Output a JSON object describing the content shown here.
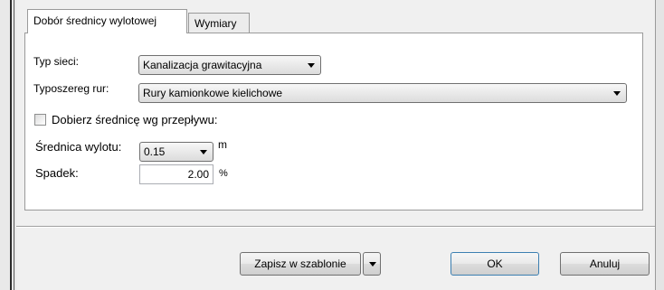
{
  "tabs": [
    {
      "label": "Dobór średnicy wylotowej",
      "active": true
    },
    {
      "label": "Wymiary",
      "active": false
    }
  ],
  "form": {
    "network_type": {
      "label": "Typ sieci:",
      "value": "Kanalizacja grawitacyjna"
    },
    "pipe_series": {
      "label": "Typoszereg rur:",
      "value": "Rury kamionkowe kielichowe"
    },
    "auto_diameter": {
      "label": "Dobierz średnicę wg przepływu:",
      "checked": false
    },
    "outlet_diameter": {
      "label": "Średnica wylotu:",
      "value": "0.15",
      "unit": "m"
    },
    "slope": {
      "label": "Spadek:",
      "value": "2.00",
      "unit": "%"
    }
  },
  "buttons": {
    "save_template": "Zapisz w szablonie",
    "ok": "OK",
    "cancel": "Anuluj"
  },
  "icons": {
    "dropdown": "chevron-down-icon"
  }
}
